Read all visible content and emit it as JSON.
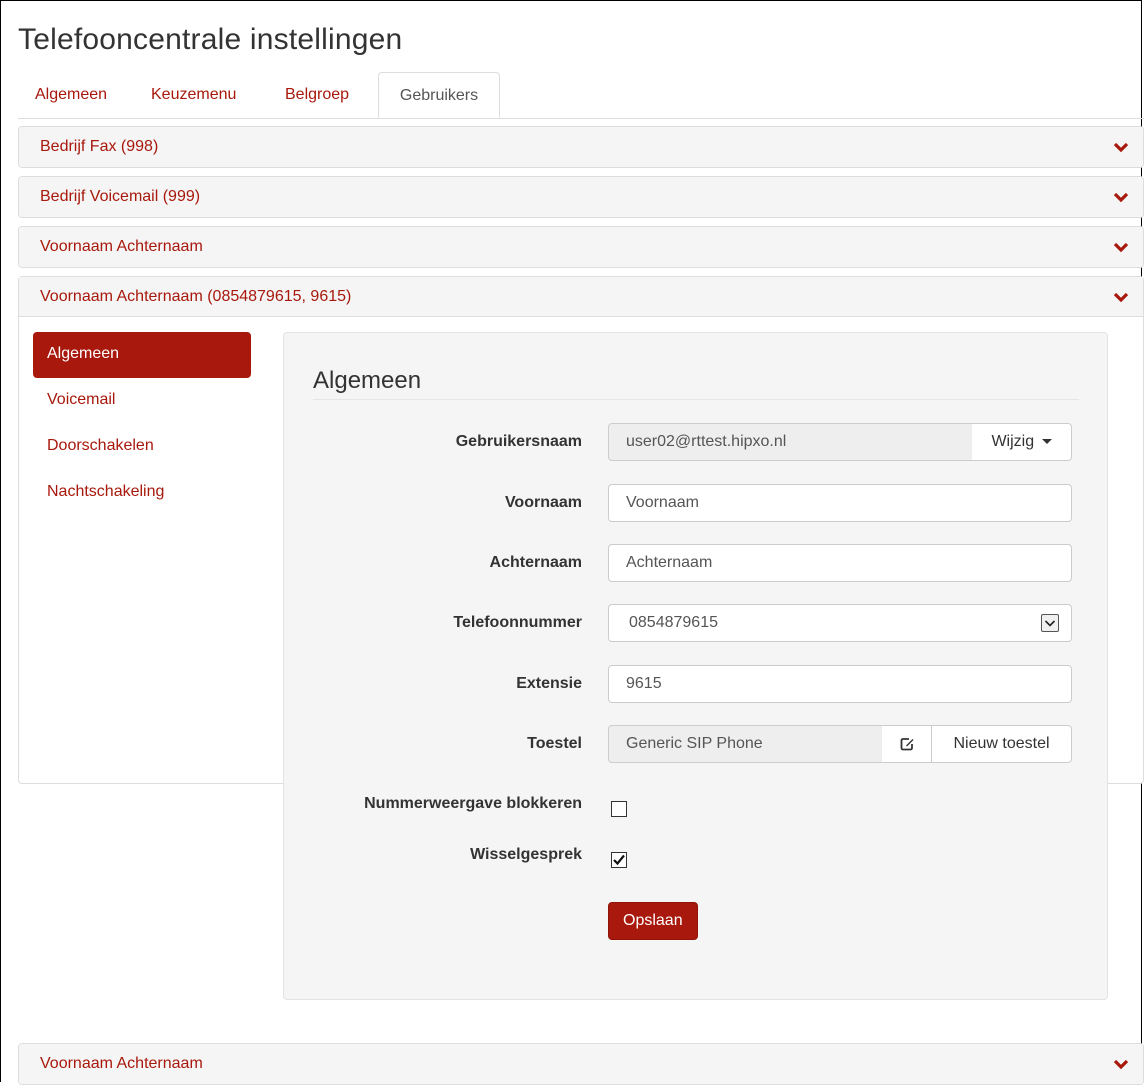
{
  "page": {
    "title": "Telefooncentrale instellingen"
  },
  "tabs": [
    {
      "label": "Algemeen"
    },
    {
      "label": "Keuzemenu"
    },
    {
      "label": "Belgroep"
    },
    {
      "label": "Gebruikers"
    }
  ],
  "panels": [
    {
      "title": "Bedrijf Fax (998)"
    },
    {
      "title": "Bedrijf Voicemail (999)"
    },
    {
      "title": "Voornaam Achternaam"
    },
    {
      "title": "Voornaam Achternaam (0854879615, 9615)"
    },
    {
      "title": "Voornaam Achternaam"
    }
  ],
  "user_nav": [
    {
      "label": "Algemeen"
    },
    {
      "label": "Voicemail"
    },
    {
      "label": "Doorschakelen"
    },
    {
      "label": "Nachtschakeling"
    }
  ],
  "form": {
    "title": "Algemeen",
    "username": {
      "label": "Gebruikersnaam",
      "value": "user02@rttest.hipxo.nl",
      "button": "Wijzig"
    },
    "firstname": {
      "label": "Voornaam",
      "value": "Voornaam"
    },
    "lastname": {
      "label": "Achternaam",
      "value": "Achternaam"
    },
    "phone": {
      "label": "Telefoonnummer",
      "value": "0854879615"
    },
    "extension": {
      "label": "Extensie",
      "value": "9615"
    },
    "device": {
      "label": "Toestel",
      "value": "Generic SIP Phone",
      "new_button": "Nieuw toestel"
    },
    "hide_number": {
      "label": "Nummerweergave blokkeren",
      "checked": false
    },
    "call_waiting": {
      "label": "Wisselgesprek",
      "checked": true
    },
    "save_label": "Opslaan"
  },
  "colors": {
    "accent": "#a8180c",
    "panel_bg": "#f5f5f5",
    "border": "#dddddd"
  },
  "icons": {
    "panel_toggle": "chevron-down-icon",
    "edit": "edit-icon",
    "select": "select-arrow-icon",
    "dropdown": "caret-down-icon"
  }
}
